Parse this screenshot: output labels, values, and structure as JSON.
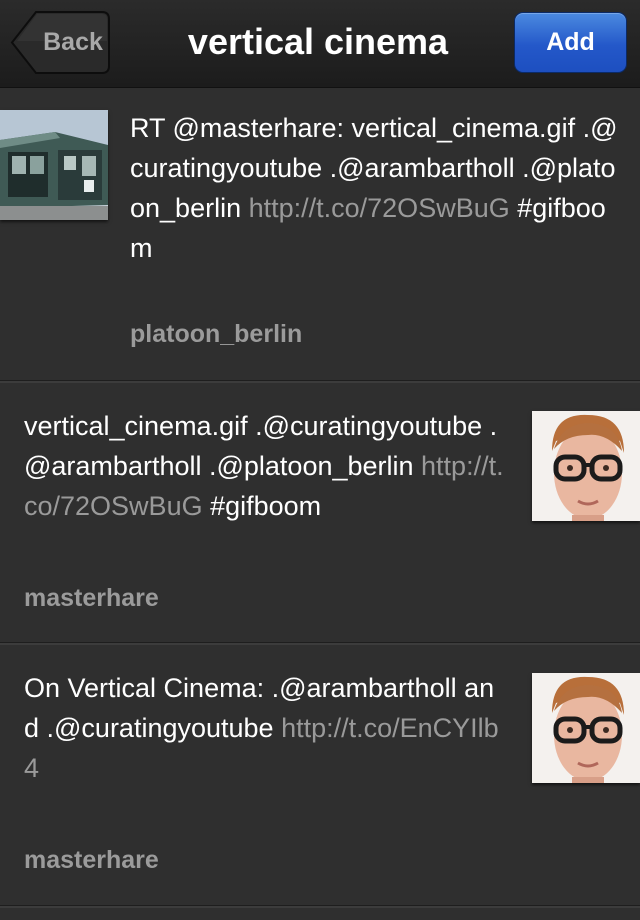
{
  "nav": {
    "back_label": "Back",
    "title": "vertical cinema",
    "add_label": "Add"
  },
  "tweets": [
    {
      "text": "RT @masterhare: vertical_cinema.gif .@curatingyoutube .@arambartholl .@platoon_berlin ",
      "link": "http://t.co/72OSwBuG",
      "after": " #gifboom",
      "user": "platoon_berlin",
      "avatar": "building-photo"
    },
    {
      "text": "vertical_cinema.gif .@curatingyoutube .@arambartholl .@platoon_berlin ",
      "link": "http://t.co/72OSwBuG",
      "after": " #gifboom",
      "user": "masterhare",
      "avatar": "person-with-glasses-photo"
    },
    {
      "text": "On Vertical Cinema: .@arambartholl and .@curatingyoutube ",
      "link": "http://t.co/EnCYIlb4",
      "after": "",
      "user": "masterhare",
      "avatar": "person-with-glasses-photo"
    }
  ],
  "colors": {
    "background": "#2f2f2f",
    "link": "#9a9a9a",
    "username": "#9b9b9b",
    "add_button": "#2458c9"
  }
}
